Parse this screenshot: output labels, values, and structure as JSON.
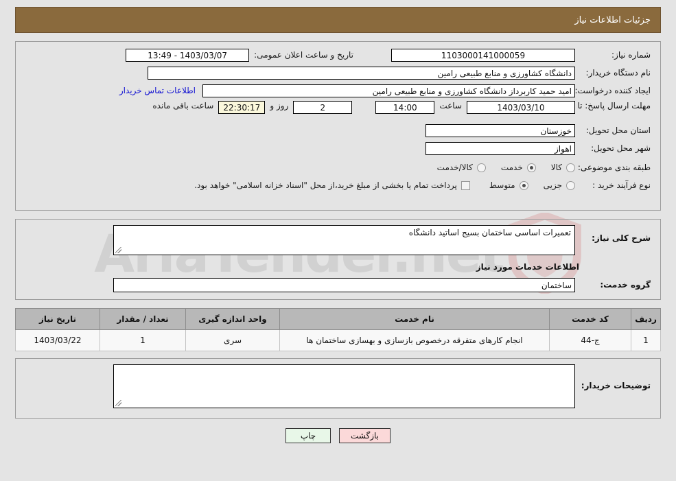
{
  "header": {
    "title": "جزئیات اطلاعات نیاز"
  },
  "colors": {
    "header_bg": "#8a6a3d",
    "page_bg": "#e4e4e4",
    "link": "#1414d2",
    "countdown_bg": "#fbf8dc",
    "back_button_bg": "#fbd9d9",
    "print_button_bg": "#e8f7e8",
    "table_header_bg": "#b8b8b8"
  },
  "watermark": {
    "text": "AriaTender.net"
  },
  "form": {
    "need_number": {
      "label": "شماره نیاز:",
      "value": "1103000141000059"
    },
    "announce_datetime": {
      "label": "تاریخ و ساعت اعلان عمومی:",
      "value": "1403/03/07 - 13:49"
    },
    "buyer_org": {
      "label": "نام دستگاه خریدار:",
      "value": "دانشگاه کشاورزی و منابع طبیعی رامین"
    },
    "requester": {
      "label": "ایجاد کننده درخواست:",
      "value": "امید حمید کاربرداز دانشگاه کشاورزی و منابع طبیعی رامین",
      "contact_link": "اطلاعات تماس خریدار"
    },
    "deadline": {
      "label": "مهلت ارسال پاسخ: تا تاریخ:",
      "date": "1403/03/10",
      "time_label": "ساعت",
      "time": "14:00",
      "days": "2",
      "days_label": "روز و",
      "countdown": "22:30:17",
      "remaining_label": "ساعت باقی مانده"
    },
    "province": {
      "label": "استان محل تحویل:",
      "value": "خوزستان"
    },
    "city": {
      "label": "شهر محل تحویل:",
      "value": "اهواز"
    },
    "category": {
      "label": "طبقه بندی موضوعی:",
      "options": [
        {
          "label": "کالا",
          "selected": false
        },
        {
          "label": "خدمت",
          "selected": true
        },
        {
          "label": "کالا/خدمت",
          "selected": false
        }
      ]
    },
    "purchase_type": {
      "label": "نوع فرآیند خرید :",
      "options": [
        {
          "label": "جزیی",
          "selected": false
        },
        {
          "label": "متوسط",
          "selected": true
        }
      ],
      "treasury_checkbox": {
        "label": "پرداخت تمام یا بخشی از مبلغ خرید،از محل \"اسناد خزانه اسلامی\" خواهد بود.",
        "checked": false
      }
    },
    "general_description": {
      "label": "شرح کلی نیاز:",
      "value": "تعمیرات اساسی ساختمان بسیج اساتید دانشگاه"
    },
    "services_section_heading": "اطلاعات خدمات مورد نیاز",
    "service_group": {
      "label": "گروه خدمت:",
      "value": "ساختمان"
    },
    "buyer_notes": {
      "label": "توضیحات خریدار:",
      "value": ""
    }
  },
  "services_table": {
    "columns": [
      "ردیف",
      "کد خدمت",
      "نام خدمت",
      "واحد اندازه گیری",
      "تعداد / مقدار",
      "تاریخ نیاز"
    ],
    "rows": [
      {
        "row_no": "1",
        "service_code": "ج-44",
        "service_name": "انجام کارهای متفرقه درخصوص بازسازی و بهسازی ساختمان ها",
        "unit": "سری",
        "quantity": "1",
        "need_date": "1403/03/22"
      }
    ]
  },
  "footer": {
    "print_label": "چاپ",
    "back_label": "بازگشت"
  }
}
